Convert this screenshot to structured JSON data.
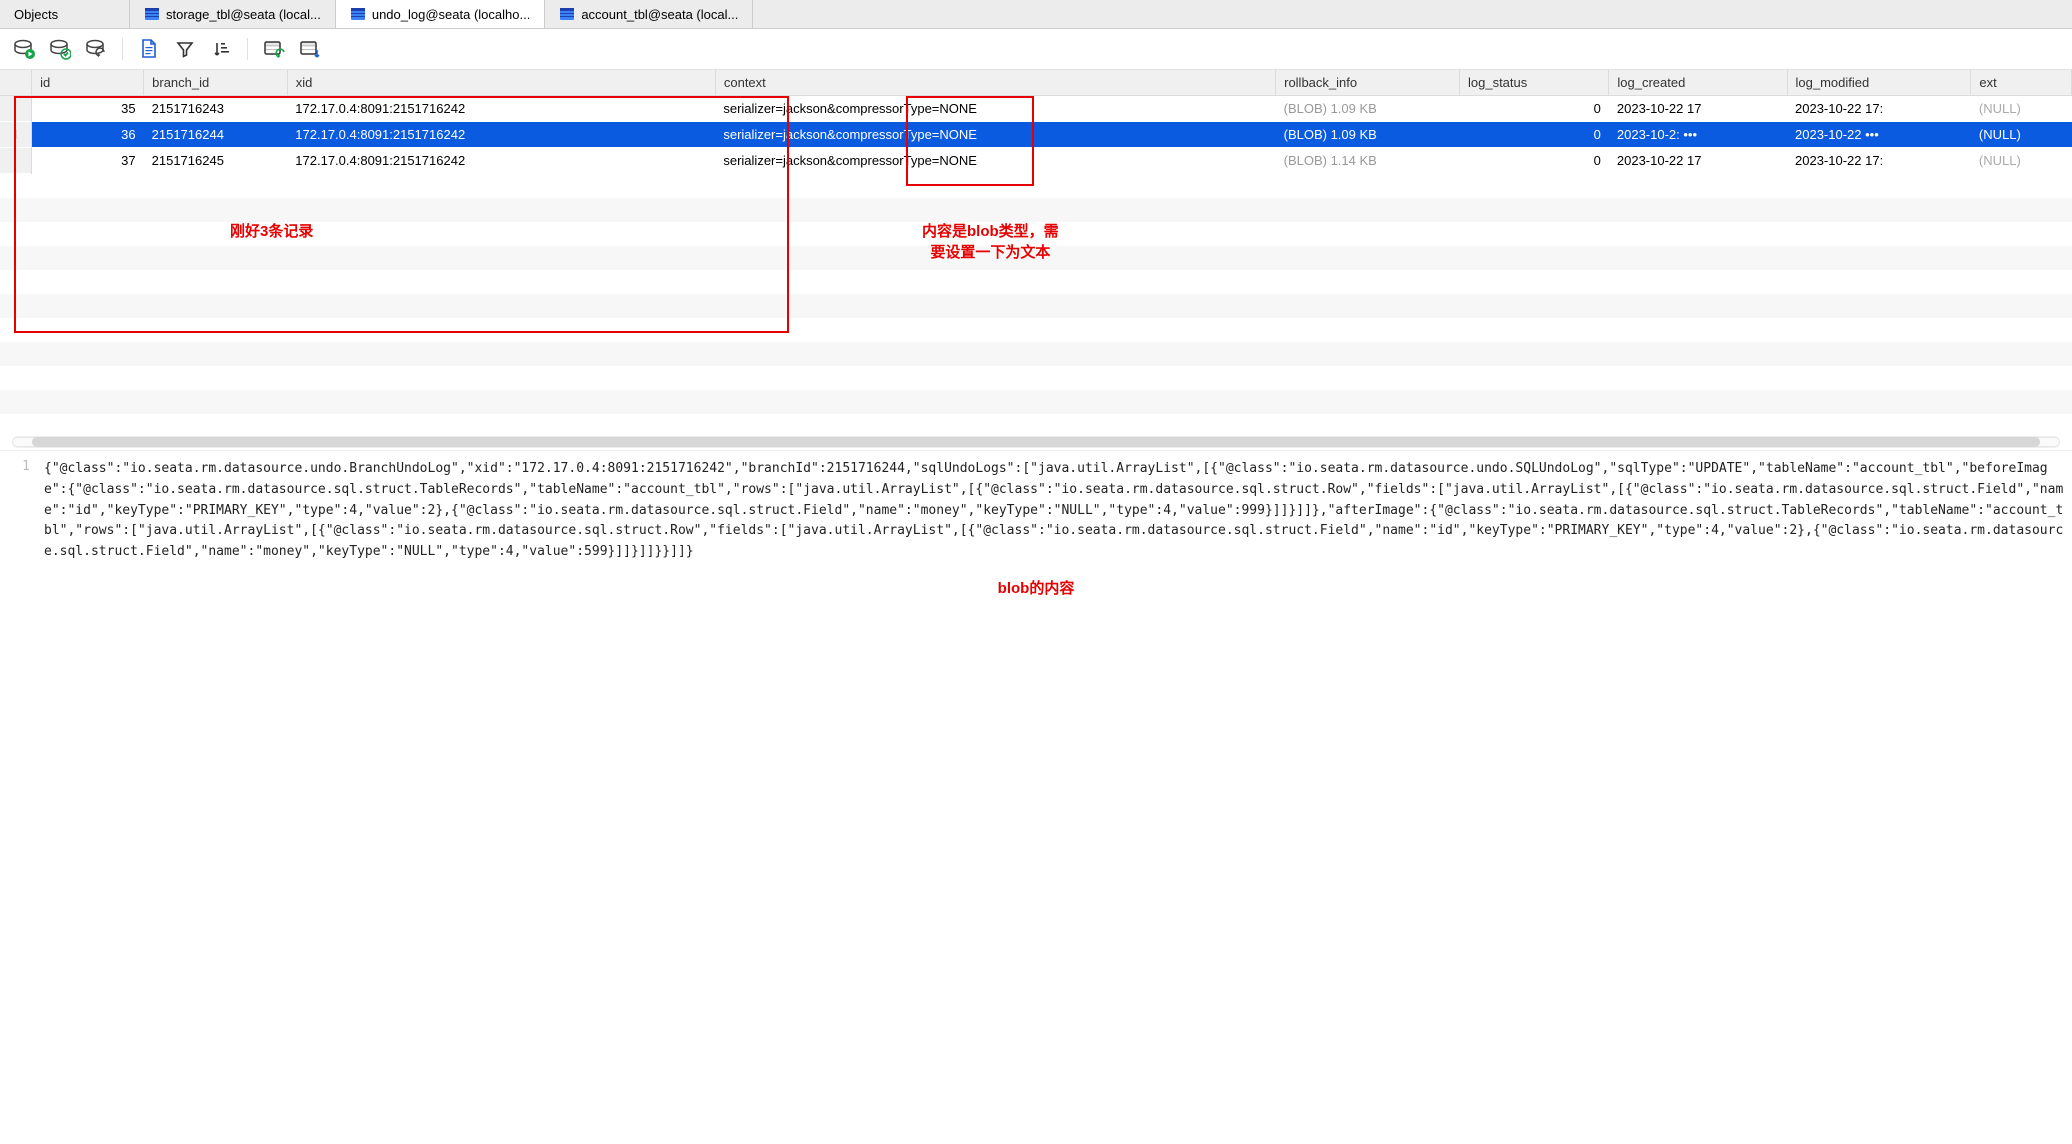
{
  "tabs": [
    {
      "label": "Objects",
      "active": false,
      "icon": null
    },
    {
      "label": "storage_tbl@seata (local...",
      "active": false,
      "icon": "table"
    },
    {
      "label": "undo_log@seata (localho...",
      "active": true,
      "icon": "table"
    },
    {
      "label": "account_tbl@seata (local...",
      "active": false,
      "icon": "table"
    }
  ],
  "columns": {
    "id": "id",
    "branch_id": "branch_id",
    "xid": "xid",
    "context": "context",
    "rollback_info": "rollback_info",
    "log_status": "log_status",
    "log_created": "log_created",
    "log_modified": "log_modified",
    "ext": "ext"
  },
  "rows": [
    {
      "id": "35",
      "branch_id": "2151716243",
      "xid": "172.17.0.4:8091:2151716242",
      "context": "serializer=jackson&compressorType=",
      "context_suffix": "NONE",
      "rollback_info": "(BLOB) 1.09 KB",
      "log_status": "0",
      "log_created": "2023-10-22 17",
      "log_modified": "2023-10-22 17:",
      "ext": "(NULL)",
      "selected": false
    },
    {
      "id": "36",
      "branch_id": "2151716244",
      "xid": "172.17.0.4:8091:2151716242",
      "context": "serializer=jackson&compressorType=",
      "context_suffix": "NONE",
      "rollback_info": "(BLOB) 1.09 KB",
      "log_status": "0",
      "log_created": "2023-10-2: •••",
      "log_modified": "2023-10-22  •••",
      "ext": "(NULL)",
      "selected": true
    },
    {
      "id": "37",
      "branch_id": "2151716245",
      "xid": "172.17.0.4:8091:2151716242",
      "context": "serializer=jackson&compressorType=",
      "context_suffix": "NONE",
      "rollback_info": "(BLOB) 1.14 KB",
      "log_status": "0",
      "log_created": "2023-10-22 17",
      "log_modified": "2023-10-22 17:",
      "ext": "(NULL)",
      "selected": false
    }
  ],
  "annotations": {
    "box1_label": "刚好3条记录",
    "box2_label": "内容是blob类型，需\n要设置一下为文本",
    "detail_label": "blob的内容"
  },
  "detail": {
    "line_no": "1",
    "content": "{\"@class\":\"io.seata.rm.datasource.undo.BranchUndoLog\",\"xid\":\"172.17.0.4:8091:2151716242\",\"branchId\":2151716244,\"sqlUndoLogs\":[\"java.util.ArrayList\",[{\"@class\":\"io.seata.rm.datasource.undo.SQLUndoLog\",\"sqlType\":\"UPDATE\",\"tableName\":\"account_tbl\",\"beforeImage\":{\"@class\":\"io.seata.rm.datasource.sql.struct.TableRecords\",\"tableName\":\"account_tbl\",\"rows\":[\"java.util.ArrayList\",[{\"@class\":\"io.seata.rm.datasource.sql.struct.Row\",\"fields\":[\"java.util.ArrayList\",[{\"@class\":\"io.seata.rm.datasource.sql.struct.Field\",\"name\":\"id\",\"keyType\":\"PRIMARY_KEY\",\"type\":4,\"value\":2},{\"@class\":\"io.seata.rm.datasource.sql.struct.Field\",\"name\":\"money\",\"keyType\":\"NULL\",\"type\":4,\"value\":999}]]}]]},\"afterImage\":{\"@class\":\"io.seata.rm.datasource.sql.struct.TableRecords\",\"tableName\":\"account_tbl\",\"rows\":[\"java.util.ArrayList\",[{\"@class\":\"io.seata.rm.datasource.sql.struct.Row\",\"fields\":[\"java.util.ArrayList\",[{\"@class\":\"io.seata.rm.datasource.sql.struct.Field\",\"name\":\"id\",\"keyType\":\"PRIMARY_KEY\",\"type\":4,\"value\":2},{\"@class\":\"io.seata.rm.datasource.sql.struct.Field\",\"name\":\"money\",\"keyType\":\"NULL\",\"type\":4,\"value\":599}]]}]]}}]]}"
  }
}
